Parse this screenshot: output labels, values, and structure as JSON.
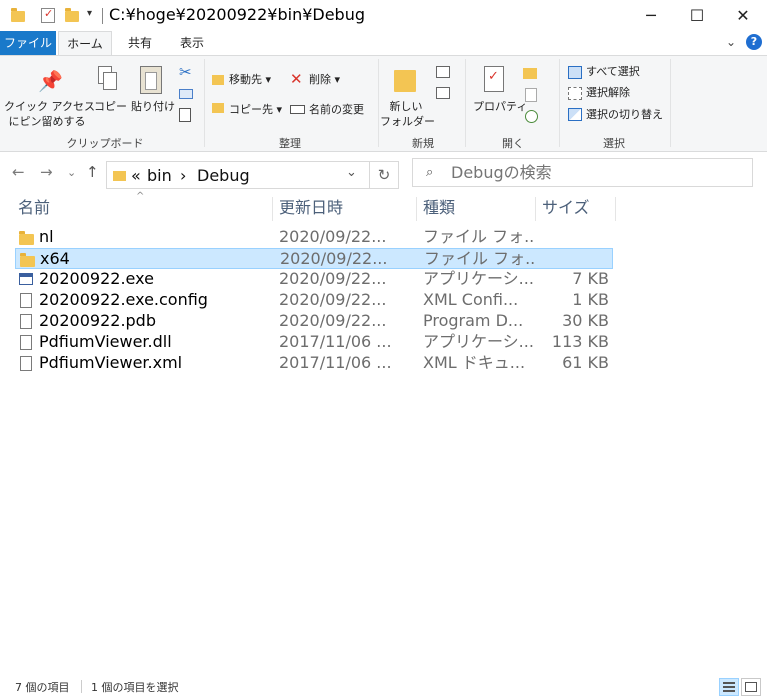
{
  "window": {
    "title": "C:¥hoge¥20200922¥bin¥Debug",
    "minimize": "─",
    "maximize": "☐",
    "close": "✕"
  },
  "ribbon_tabs": [
    {
      "label": "ファイル"
    },
    {
      "label": "ホーム"
    },
    {
      "label": "共有"
    },
    {
      "label": "表示"
    }
  ],
  "ribbon": {
    "clipboard": {
      "label": "クリップボード",
      "pin_line1": "クイック アクセス",
      "pin_line2": "にピン留めする",
      "copy": "コピー",
      "paste": "貼り付け"
    },
    "organize": {
      "label": "整理",
      "move_to": "移動先",
      "copy_to": "コピー先",
      "delete": "削除",
      "rename": "名前の変更"
    },
    "new": {
      "label": "新規",
      "new_folder_line1": "新しい",
      "new_folder_line2": "フォルダー"
    },
    "open": {
      "label": "開く",
      "properties": "プロパティ"
    },
    "select": {
      "label": "選択",
      "select_all": "すべて選択",
      "select_none": "選択解除",
      "invert": "選択の切り替え"
    }
  },
  "address": {
    "overflow": "«",
    "crumbs": [
      "bin",
      "Debug"
    ],
    "separator": "›",
    "search_placeholder": "Debugの検索"
  },
  "columns": {
    "name": "名前",
    "date": "更新日時",
    "type": "種類",
    "size": "サイズ"
  },
  "files": [
    {
      "name": "nl",
      "date": "2020/09/22...",
      "type": "ファイル フォ...",
      "size": "",
      "icon": "folder-icon",
      "selected": false
    },
    {
      "name": "x64",
      "date": "2020/09/22...",
      "type": "ファイル フォ...",
      "size": "",
      "icon": "folder-icon",
      "selected": true
    },
    {
      "name": "20200922.exe",
      "date": "2020/09/22...",
      "type": "アプリケーシ...",
      "size": "7 KB",
      "icon": "exe-icon",
      "selected": false
    },
    {
      "name": "20200922.exe.config",
      "date": "2020/09/22...",
      "type": "XML Confi...",
      "size": "1 KB",
      "icon": "config-icon",
      "selected": false
    },
    {
      "name": "20200922.pdb",
      "date": "2020/09/22...",
      "type": "Program D...",
      "size": "30 KB",
      "icon": "document-icon",
      "selected": false
    },
    {
      "name": "PdfiumViewer.dll",
      "date": "2017/11/06 ...",
      "type": "アプリケーシ...",
      "size": "113 KB",
      "icon": "dll-icon",
      "selected": false
    },
    {
      "name": "PdfiumViewer.xml",
      "date": "2017/11/06 ...",
      "type": "XML ドキュ...",
      "size": "61 KB",
      "icon": "document-icon",
      "selected": false
    }
  ],
  "status": {
    "item_count": "7 個の項目",
    "selected_count": "1 個の項目を選択"
  },
  "colors": {
    "file_tab": "#1979ca",
    "selection": "#cce8ff",
    "folder": "#f3c553"
  }
}
